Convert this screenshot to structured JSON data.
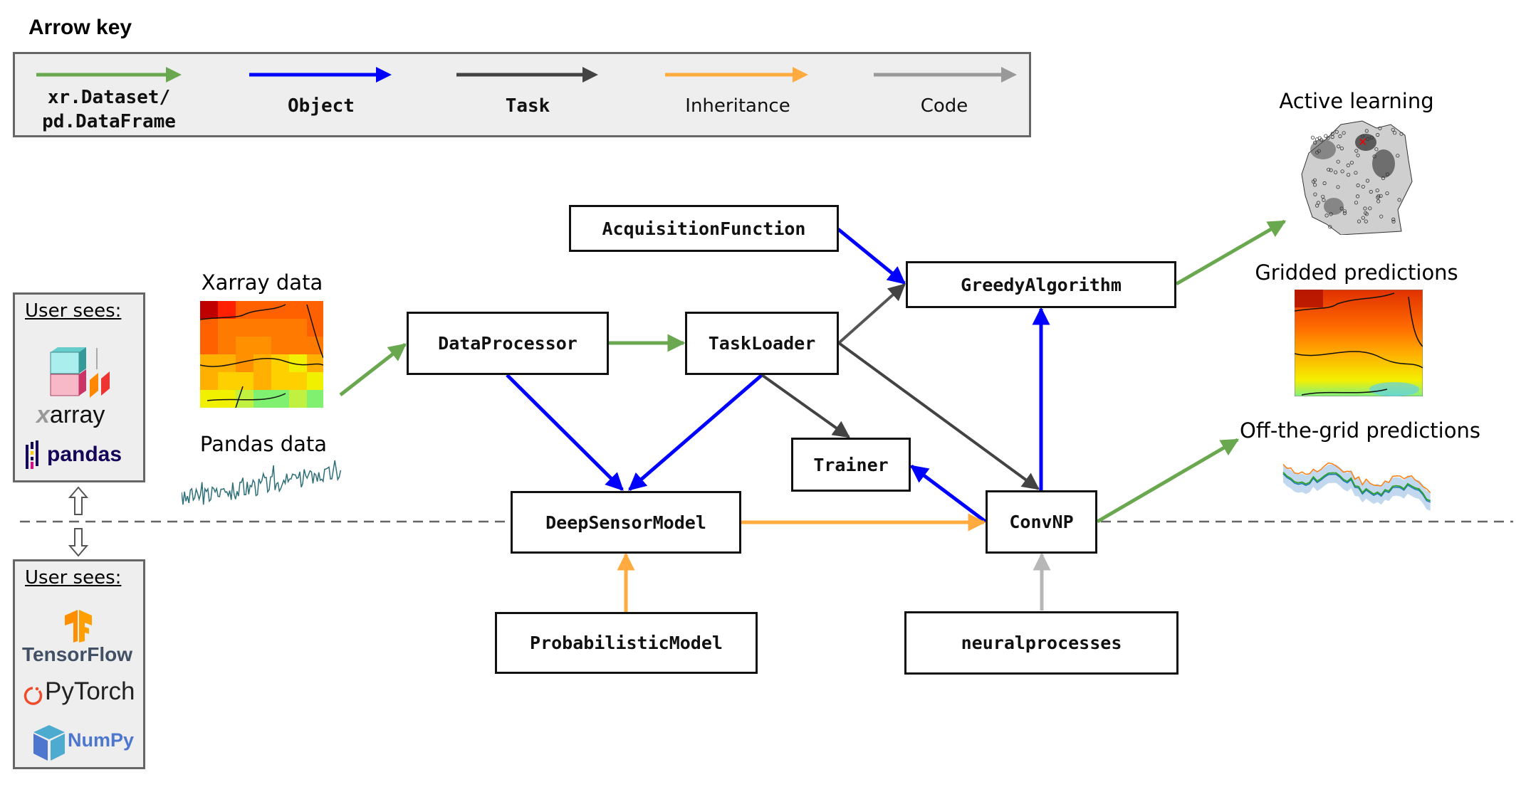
{
  "arrow_key": {
    "title": "Arrow key",
    "items": [
      {
        "label_line1": "xr.Dataset/",
        "label_line2": "pd.DataFrame",
        "meaning": "data",
        "color": "#6aa84f"
      },
      {
        "label_line1": "Object",
        "meaning": "object",
        "color": "#0000ff"
      },
      {
        "label_line1": "Task",
        "meaning": "task",
        "color": "#434343"
      },
      {
        "label_line1": "Inheritance",
        "meaning": "inheritance",
        "color": "#ffab40"
      },
      {
        "label_line1": "Code",
        "meaning": "code",
        "color": "#999999"
      }
    ]
  },
  "user_panels": {
    "top": {
      "title": "User sees:",
      "logos": [
        {
          "name": "xarray",
          "text": "array",
          "prefix": "x"
        },
        {
          "name": "pandas",
          "text": "pandas"
        }
      ]
    },
    "bottom": {
      "title": "User sees:",
      "logos": [
        {
          "name": "tensorflow",
          "text": "TensorFlow"
        },
        {
          "name": "pytorch",
          "text": "PyTorch"
        },
        {
          "name": "numpy",
          "text": "NumPy"
        }
      ]
    }
  },
  "inputs": {
    "xarray_label": "Xarray data",
    "pandas_label": "Pandas data"
  },
  "outputs": {
    "active_learning_label": "Active learning",
    "gridded_label": "Gridded predictions",
    "offgrid_label": "Off-the-grid predictions"
  },
  "nodes": {
    "acquisition_function": "AcquisitionFunction",
    "data_processor": "DataProcessor",
    "task_loader": "TaskLoader",
    "greedy_algorithm": "GreedyAlgorithm",
    "trainer": "Trainer",
    "deep_sensor_model": "DeepSensorModel",
    "conv_np": "ConvNP",
    "probabilistic_model": "ProbabilisticModel",
    "neural_processes": "neuralprocesses"
  },
  "edges": [
    {
      "from": "xarray-data",
      "to": "data_processor",
      "type": "data"
    },
    {
      "from": "data_processor",
      "to": "task_loader",
      "type": "data"
    },
    {
      "from": "data_processor",
      "to": "deep_sensor_model",
      "type": "object"
    },
    {
      "from": "task_loader",
      "to": "deep_sensor_model",
      "type": "object"
    },
    {
      "from": "acquisition_function",
      "to": "greedy_algorithm",
      "type": "object"
    },
    {
      "from": "task_loader",
      "to": "greedy_algorithm",
      "type": "task"
    },
    {
      "from": "task_loader",
      "to": "trainer",
      "type": "task"
    },
    {
      "from": "task_loader",
      "to": "conv_np",
      "type": "task"
    },
    {
      "from": "conv_np",
      "to": "trainer",
      "type": "object"
    },
    {
      "from": "conv_np",
      "to": "greedy_algorithm",
      "type": "object"
    },
    {
      "from": "deep_sensor_model",
      "to": "conv_np",
      "type": "inheritance"
    },
    {
      "from": "probabilistic_model",
      "to": "deep_sensor_model",
      "type": "inheritance"
    },
    {
      "from": "neural_processes",
      "to": "conv_np",
      "type": "code"
    },
    {
      "from": "greedy_algorithm",
      "to": "active-learning",
      "type": "data"
    },
    {
      "from": "conv_np",
      "to": "offgrid-predictions",
      "type": "data"
    }
  ],
  "colors": {
    "data": "#6aa84f",
    "object": "#0000ff",
    "task": "#434343",
    "inheritance": "#ffab40",
    "code": "#b7b7b7",
    "panel_bg": "#eeeeee",
    "divider": "#666666"
  }
}
